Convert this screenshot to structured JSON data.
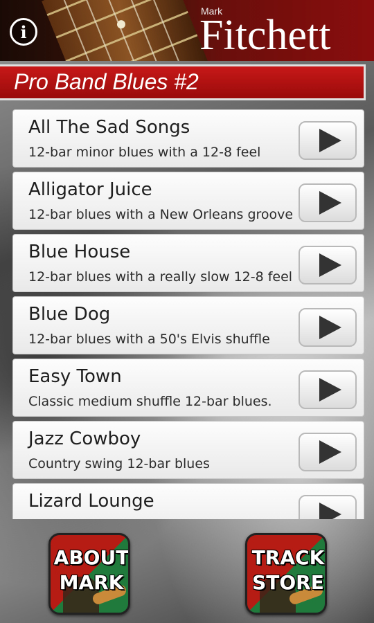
{
  "header": {
    "info_icon": "info-icon",
    "brand_first": "Mark",
    "brand_last": "Fitchett"
  },
  "title": "Pro Band Blues #2",
  "tracks": [
    {
      "title": "All The Sad Songs",
      "subtitle": "12-bar minor blues with a 12-8 feel"
    },
    {
      "title": "Alligator Juice",
      "subtitle": "12-bar blues with a New Orleans groove"
    },
    {
      "title": "Blue House",
      "subtitle": "12-bar blues with a really slow 12-8 feel"
    },
    {
      "title": "Blue Dog",
      "subtitle": "12-bar blues with a 50's Elvis shuffle"
    },
    {
      "title": "Easy Town",
      "subtitle": "Classic medium shuffle 12-bar blues."
    },
    {
      "title": "Jazz Cowboy",
      "subtitle": "Country swing 12-bar blues"
    },
    {
      "title": "Lizard Lounge",
      "subtitle": ""
    }
  ],
  "play_icon": "play-icon",
  "bottom": {
    "about_line1": "ABOUT",
    "about_line2": "MARK",
    "store_line1": "TRACK",
    "store_line2": "STORE"
  }
}
